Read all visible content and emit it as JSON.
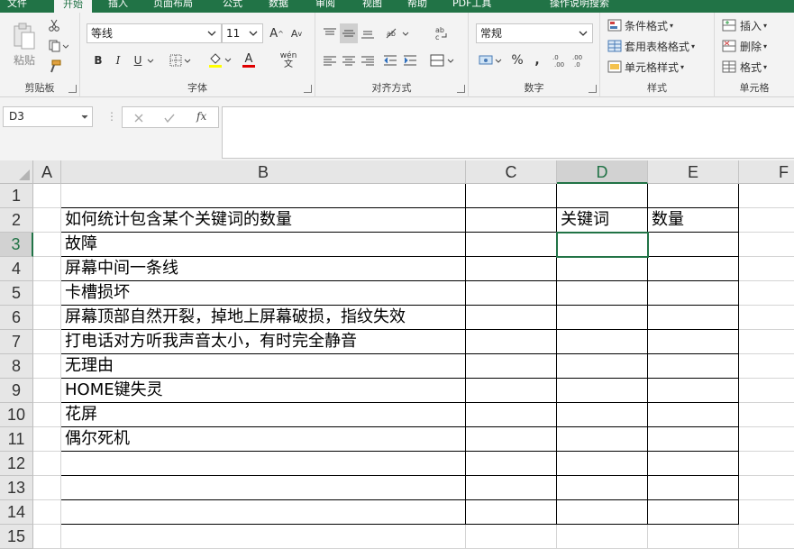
{
  "tabs": [
    "文件",
    "开始",
    "插入",
    "页面布局",
    "公式",
    "数据",
    "审阅",
    "视图",
    "帮助",
    "PDF工具",
    "操作说明搜索"
  ],
  "ribbon": {
    "clipboard": {
      "paste": "粘贴",
      "label": "剪贴板"
    },
    "font": {
      "name": "等线",
      "size": "11",
      "label": "字体",
      "bold": "B",
      "italic": "I",
      "underline": "U",
      "grow": "A",
      "shrink": "A",
      "font_color": "A",
      "phonetic": "wén"
    },
    "alignment": {
      "label": "对齐方式"
    },
    "number": {
      "format": "常规",
      "label": "数字",
      "percent": "%",
      "comma": ","
    },
    "styles": {
      "conditional": "条件格式",
      "table": "套用表格格式",
      "cell": "单元格样式",
      "label": "样式"
    },
    "cells": {
      "insert": "插入",
      "delete": "删除",
      "format": "格式",
      "label": "单元格"
    }
  },
  "formula_bar": {
    "name_box": "D3",
    "fx": "fx",
    "value": ""
  },
  "columns": [
    "A",
    "B",
    "C",
    "D",
    "E",
    "F"
  ],
  "rows": [
    "1",
    "2",
    "3",
    "4",
    "5",
    "6",
    "7",
    "8",
    "9",
    "10",
    "11",
    "12",
    "13",
    "14",
    "15"
  ],
  "selected_cell": "D3",
  "cells": {
    "B2": "如何统计包含某个关键词的数量",
    "D2": "关键词",
    "E2": "数量",
    "B3": "故障",
    "B4": "屏幕中间一条线",
    "B5": "卡槽损坏",
    "B6": "屏幕顶部自然开裂，掉地上屏幕破损，指纹失效",
    "B7": "打电话对方听我声音太小，有时完全静音",
    "B8": "无理由",
    "B9": "HOME键失灵",
    "B10": "花屏",
    "B11": "偶尔死机"
  },
  "colors": {
    "accent": "#217346",
    "ribbon_bg": "#f3f3f3",
    "header_bg": "#e6e6e6"
  }
}
